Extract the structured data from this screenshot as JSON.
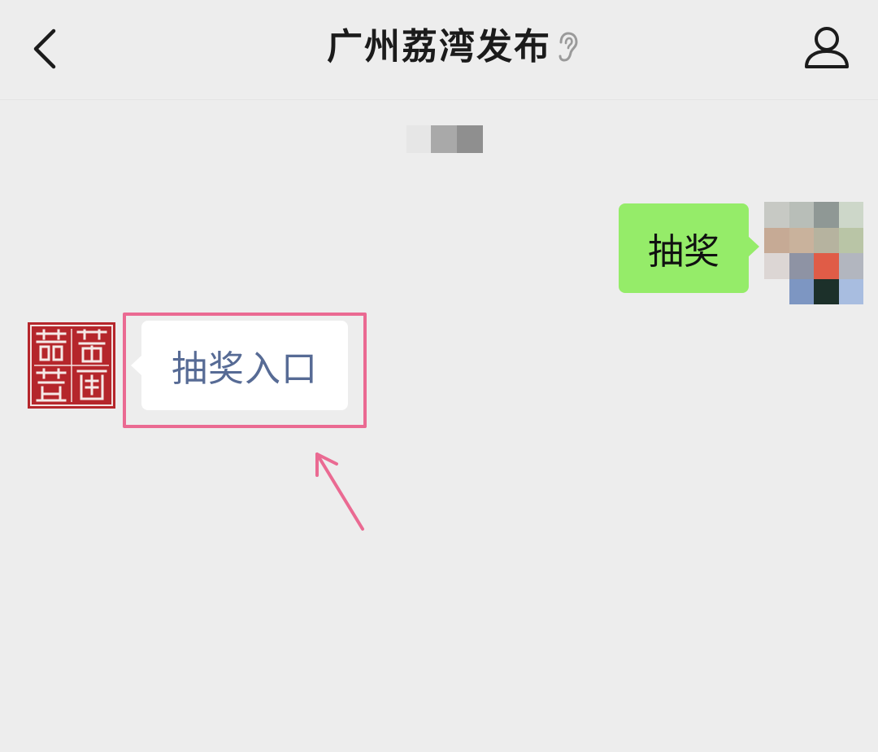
{
  "header": {
    "title": "广州荔湾发布",
    "back_icon": "chevron-left-icon",
    "voice_icon": "ear-icon",
    "profile_icon": "person-icon"
  },
  "messages": [
    {
      "sender": "self",
      "text": "抽奖",
      "bubble_color": "#95ec69"
    },
    {
      "sender": "official_account",
      "text": "抽奖入口",
      "bubble_color": "#ffffff",
      "link_color": "#576b95"
    }
  ],
  "annotation": {
    "highlight_color": "#ea6a92",
    "arrow_icon": "pointer-arrow-icon"
  },
  "colors": {
    "background": "#ededed",
    "seal_red": "#b5262b"
  }
}
